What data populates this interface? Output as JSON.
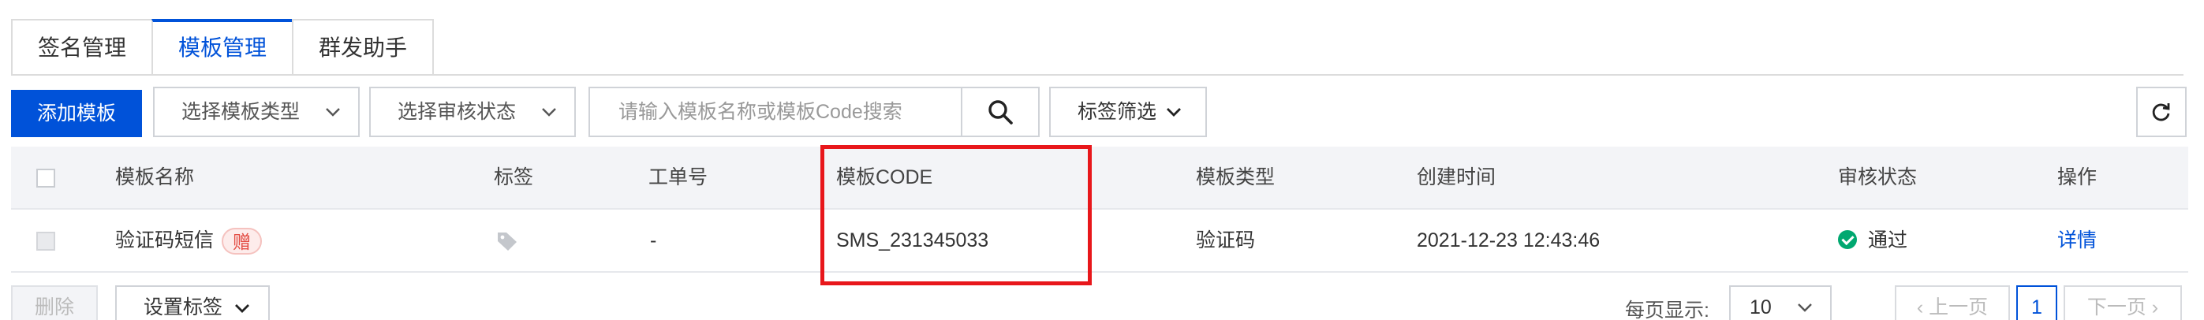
{
  "tabs": [
    {
      "label": "签名管理",
      "active": false
    },
    {
      "label": "模板管理",
      "active": true
    },
    {
      "label": "群发助手",
      "active": false
    }
  ],
  "toolbar": {
    "add_label": "添加模板",
    "type_select": "选择模板类型",
    "status_select": "选择审核状态",
    "search_placeholder": "请输入模板名称或模板Code搜索",
    "tag_filter": "标签筛选",
    "icons": {
      "search": "search-icon",
      "refresh": "refresh-icon",
      "chevron": "chevron-down-icon"
    }
  },
  "table": {
    "columns": [
      "模板名称",
      "标签",
      "工单号",
      "模板CODE",
      "模板类型",
      "创建时间",
      "审核状态",
      "操作"
    ],
    "rows": [
      {
        "name": "验证码短信",
        "badge": "赠",
        "tag_icon": "tag-icon",
        "ticket": "-",
        "code": "SMS_231345033",
        "type": "验证码",
        "created": "2021-12-23 12:43:46",
        "status": "通过",
        "action": "详情"
      }
    ]
  },
  "footer": {
    "delete_label": "删除",
    "set_tag_label": "设置标签",
    "per_page_label": "每页显示:",
    "per_page_value": "10",
    "prev_label": "上一页",
    "current_page": "1",
    "next_label": "下一页"
  },
  "colors": {
    "accent": "#0052d9",
    "success": "#00a870",
    "highlight": "#e8171b"
  }
}
